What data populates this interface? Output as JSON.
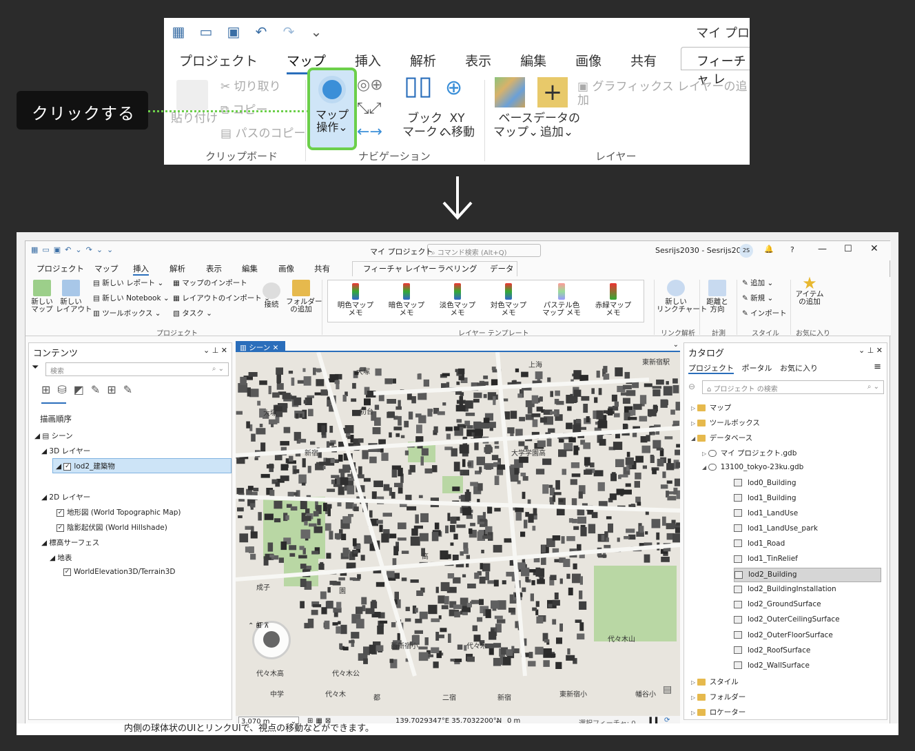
{
  "callout": {
    "text": "クリックする"
  },
  "ribbon_crop": {
    "title": "マイ プロ",
    "tabs": [
      "プロジェクト",
      "マップ",
      "挿入",
      "解析",
      "表示",
      "編集",
      "画像",
      "共有"
    ],
    "active_tab": "マップ",
    "feature_tab": "フィーチャ レ",
    "clipboard": {
      "paste": "貼り付け",
      "cut": "切り取り",
      "copy": "コピー",
      "copy_path": "パスのコピー",
      "group": "クリップボード"
    },
    "navigation": {
      "map_op_line1": "マップ",
      "map_op_line2": "操作",
      "bookmark_line1": "ブック",
      "bookmark_line2": "マーク",
      "xy_line1": "XY",
      "xy_line2": "へ移動",
      "group": "ナビゲーション"
    },
    "layer": {
      "basemap_line1": "ベース",
      "basemap_line2": "マップ",
      "add_data_line1": "データの",
      "add_data_line2": "追加",
      "graphics": "グラフィックス レイヤーの追加",
      "group": "レイヤー"
    }
  },
  "window": {
    "title": "マイ プロジェクト",
    "command_search": "コマンド検索 (Alt+Q)",
    "user": "Sesrijs2030 - Sesrijs2030",
    "avatar": "2S",
    "help": "?",
    "tabs": [
      "プロジェクト",
      "マップ",
      "挿入",
      "解析",
      "表示",
      "編集",
      "画像",
      "共有"
    ],
    "active_tab": "挿入",
    "contextual_tabs": [
      "フィーチャ レイヤー",
      "ラベリング",
      "データ"
    ],
    "project_group": {
      "new_map": "新しい\nマップ",
      "new_layout": "新しい\nレイアウト",
      "new_report": "新しい レポート",
      "new_notebook": "新しい Notebook",
      "toolbox": "ツールボックス",
      "import_map": "マップのインポート",
      "import_layout": "レイアウトのインポート",
      "task": "タスク",
      "connect": "接続",
      "add_folder": "フォルダー\nの追加",
      "label": "プロジェクト"
    },
    "layer_templates": {
      "items": [
        "明色マップ\nメモ",
        "暗色マップ\nメモ",
        "淡色マップ\nメモ",
        "対色マップ\nメモ",
        "パステル色\nマップ メモ",
        "赤緑マップ\nメモ"
      ],
      "label": "レイヤー テンプレート"
    },
    "link_group": {
      "new_link_chart": "新しい\nリンクチャート",
      "label": "リンク解析"
    },
    "measure_group": {
      "distance": "距離と\n方向",
      "label": "計測"
    },
    "style_group": {
      "add": "追加",
      "new": "新規",
      "import": "インポート",
      "label": "スタイル"
    },
    "fav_group": {
      "add_item": "アイテム\nの追加",
      "label": "お気に入り"
    }
  },
  "contents": {
    "title": "コンテンツ",
    "search_placeholder": "検索",
    "draw_order": "描画順序",
    "scene": "シーン",
    "layer3d": "3D レイヤー",
    "lod2": "lod2_建築物",
    "layer2d": "2D レイヤー",
    "topo": "地形図 (World Topographic Map)",
    "hillshade": "陰影起伏図 (World Hillshade)",
    "elevation": "標高サーフェス",
    "ground": "地表",
    "terrain": "WorldElevation3D/Terrain3D"
  },
  "scene_tab": {
    "label": "シーン"
  },
  "map_labels": [
    "大塚",
    "大塚",
    "上海",
    "東新宿駅",
    "成子",
    "西新宿小",
    "代々木",
    "東新宿",
    "代々木",
    "代々木高",
    "幡谷小",
    "初台",
    "大学学園高",
    "新宿",
    "代々木公",
    "園",
    "高",
    "二宿",
    "都",
    "中学",
    "小",
    "新宿",
    "代々木山",
    "初台"
  ],
  "status": {
    "scale": "3,070 m",
    "coords": "139.7029347°E 35.7032200°N",
    "elev": "0 m",
    "selected": "選択フィーチャ: 0"
  },
  "catalog": {
    "title": "カタログ",
    "tabs": [
      "プロジェクト",
      "ポータル",
      "お気に入り"
    ],
    "search_placeholder": "プロジェクト の検索",
    "items": [
      "マップ",
      "ツールボックス",
      "データベース",
      "マイ プロジェクト.gdb",
      "13100_tokyo-23ku.gdb",
      "lod0_Building",
      "lod1_Building",
      "lod1_LandUse",
      "lod1_LandUse_park",
      "lod1_Road",
      "lod1_TinRelief",
      "lod2_Building",
      "lod2_BuildingInstallation",
      "lod2_GroundSurface",
      "lod2_OuterCeilingSurface",
      "lod2_OuterFloorSurface",
      "lod2_RoofSurface",
      "lod2_WallSurface",
      "スタイル",
      "フォルダー",
      "ロケーター"
    ]
  },
  "caption": "内側の球体状のUIとリンクUIで、視点の移動などができます。",
  "colors": {
    "accent": "#2a6ebb",
    "highlight": "#6ccf4a",
    "selected_row": "#cde4f7"
  }
}
